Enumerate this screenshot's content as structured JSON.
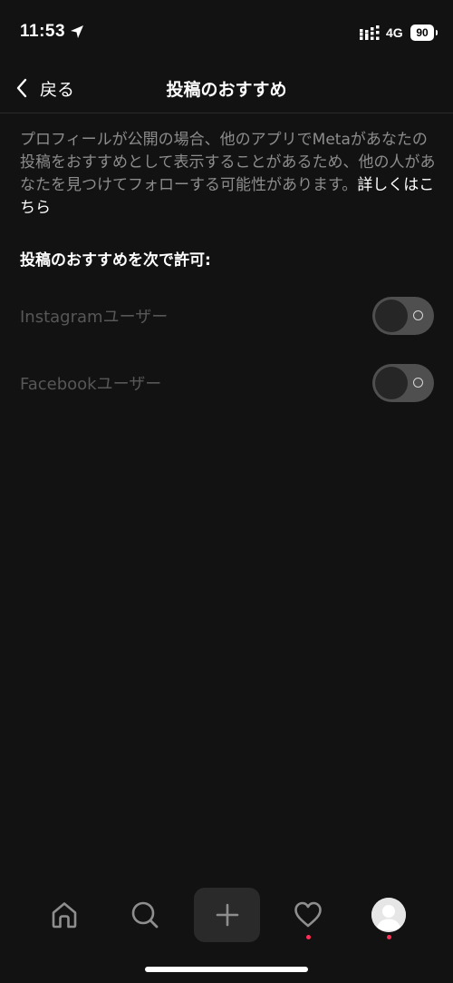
{
  "status_bar": {
    "time": "11:53",
    "network": "4G",
    "battery": "90"
  },
  "header": {
    "back_label": "戻る",
    "title": "投稿のおすすめ"
  },
  "description": {
    "text": "プロフィールが公開の場合、他のアプリでMetaがあなたの投稿をおすすめとして表示することがあるため、他の人があなたを見つけてフォローする可能性があります。",
    "link_text": "詳しくはこちら"
  },
  "section": {
    "title": "投稿のおすすめを次で許可:"
  },
  "settings": [
    {
      "label": "Instagramユーザー",
      "enabled": false
    },
    {
      "label": "Facebookユーザー",
      "enabled": false
    }
  ],
  "tab_bar": {
    "icons": [
      "home-icon",
      "search-icon",
      "plus-icon",
      "heart-icon",
      "avatar"
    ],
    "notification_color": "#ff2e55"
  },
  "colors": {
    "background": "#121212",
    "muted_text": "#8c8c8c",
    "disabled_text": "#575757",
    "toggle_track": "#4f4f4f"
  }
}
